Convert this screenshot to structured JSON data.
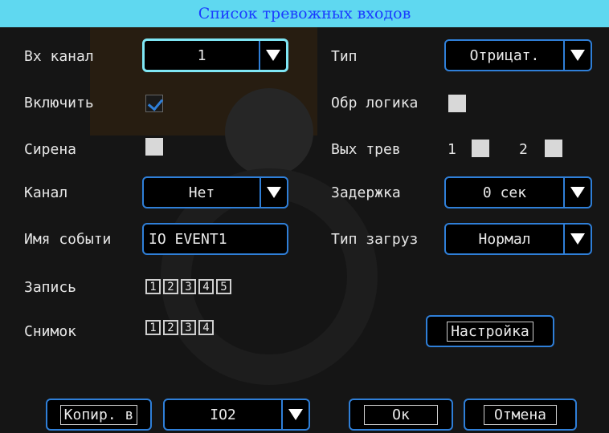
{
  "title": "Список тревожных входов",
  "fields": {
    "input_channel": {
      "label": "Вх канал",
      "value": "1"
    },
    "type": {
      "label": "Тип",
      "value": "Отрицат."
    },
    "enable": {
      "label": "Включить",
      "checked": true
    },
    "invert_logic": {
      "label": "Обр логика",
      "checked": false
    },
    "siren": {
      "label": "Сирена",
      "checked": false
    },
    "alarm_out": {
      "label": "Вых трев",
      "outputs": [
        {
          "num": "1",
          "checked": false
        },
        {
          "num": "2",
          "checked": false
        }
      ]
    },
    "channel": {
      "label": "Канал",
      "value": "Нет"
    },
    "delay": {
      "label": "Задержка",
      "value": "0 сек"
    },
    "event_name": {
      "label": "Имя событи",
      "value": "IO EVENT1"
    },
    "upload_type": {
      "label": "Тип загруз",
      "value": "Нормал"
    },
    "record": {
      "label": "Запись",
      "channels": [
        "1",
        "2",
        "3",
        "4",
        "5"
      ]
    },
    "snapshot": {
      "label": "Снимок",
      "channels": [
        "1",
        "2",
        "3",
        "4"
      ]
    }
  },
  "buttons": {
    "setup": "Настройка",
    "copy_to": "Копир. в",
    "copy_target": "IO2",
    "ok": "Ок",
    "cancel": "Отмена"
  },
  "colors": {
    "titlebar_bg": "#5fd8f0",
    "title_text": "#1a3cff",
    "border": "#2f7fd8",
    "focus_border": "#7fe7f5"
  }
}
